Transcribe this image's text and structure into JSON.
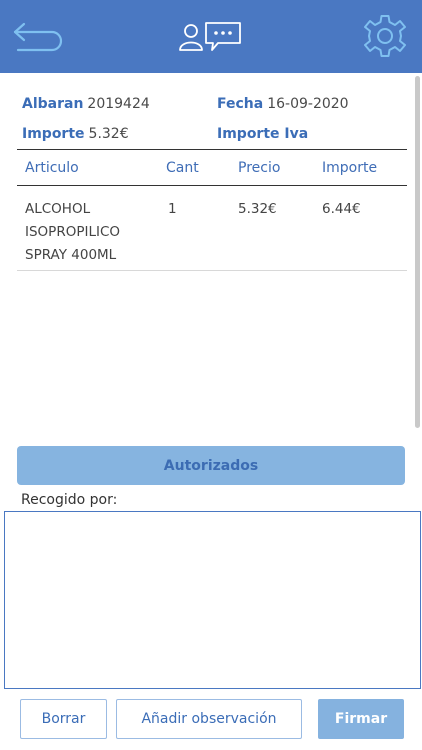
{
  "header": {
    "back_icon": "back-arrow-icon",
    "chat_icon": "user-chat-icon",
    "settings_icon": "gear-icon",
    "background_color": "#4a78c2"
  },
  "info": {
    "albaran_label": "Albaran",
    "albaran_value": "2019424",
    "fecha_label": "Fecha",
    "fecha_value": "16-09-2020",
    "importe_label": "Importe",
    "importe_value": "5.32€",
    "importe_iva_label": "Importe Iva",
    "importe_iva_value": ""
  },
  "table": {
    "columns": [
      "Articulo",
      "Cant",
      "Precio",
      "Importe"
    ],
    "rows": [
      {
        "articulo_lines": [
          "ALCOHOL",
          "ISOPROPILICO",
          "SPRAY 400ML"
        ],
        "cant": "1",
        "precio": "5.32€",
        "importe": "6.44€"
      }
    ]
  },
  "authorized_button": "Autorizados",
  "recogido_label": "Recogido por:",
  "buttons": {
    "borrar": "Borrar",
    "observacion": "Añadir observación",
    "firmar": "Firmar"
  }
}
